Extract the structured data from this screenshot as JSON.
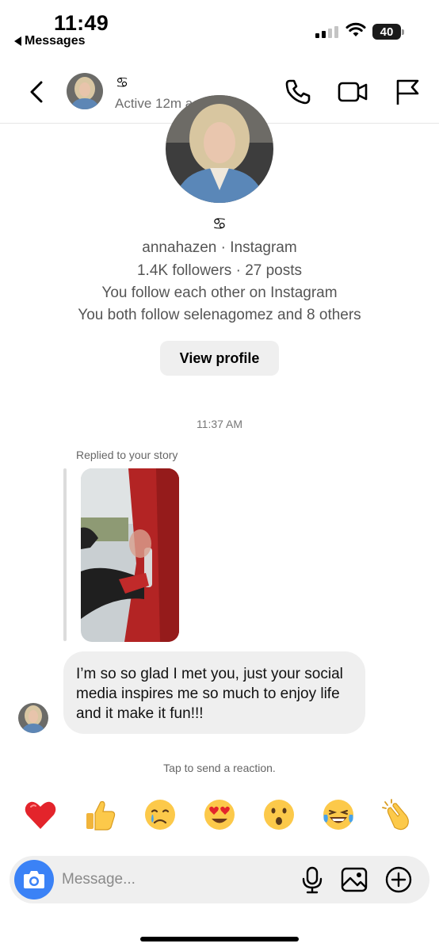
{
  "status_bar": {
    "time": "11:49",
    "back_app": "Messages",
    "battery": "40"
  },
  "header": {
    "name_symbol": "♋︎",
    "active_status": "Active 12m ago",
    "icons": [
      "back-chevron-icon",
      "phone-icon",
      "video-camera-icon",
      "flag-icon"
    ]
  },
  "profile": {
    "symbol": "♋︎",
    "username_line": "annahazen · Instagram",
    "stats_line": "1.4K followers · 27 posts",
    "mutual_line": "You follow each other on Instagram",
    "common_line": "You both follow selenagomez and 8 others",
    "view_profile_label": "View profile"
  },
  "thread": {
    "timestamp": "11:37 AM",
    "reply_label": "Replied to your story",
    "message_text": "I’m so so glad I met you, just your social media inspires me so much to enjoy life and it make it fun!!!",
    "reaction_hint": "Tap to send a reaction."
  },
  "reactions": [
    {
      "name": "heart",
      "emoji": "❤️"
    },
    {
      "name": "thumbs-up",
      "emoji": "👍"
    },
    {
      "name": "crying-face",
      "emoji": "😢"
    },
    {
      "name": "heart-eyes",
      "emoji": "😍"
    },
    {
      "name": "surprised-face",
      "emoji": "😮"
    },
    {
      "name": "laughing-face",
      "emoji": "😂"
    },
    {
      "name": "clapping-hands",
      "emoji": "👏"
    }
  ],
  "composer": {
    "placeholder": "Message...",
    "icons": [
      "camera-icon",
      "microphone-icon",
      "image-icon",
      "plus-circle-icon"
    ]
  },
  "colors": {
    "accent_blue": "#3b82f6",
    "bubble_gray": "#efefef",
    "secondary_text": "#6e6e6e"
  }
}
